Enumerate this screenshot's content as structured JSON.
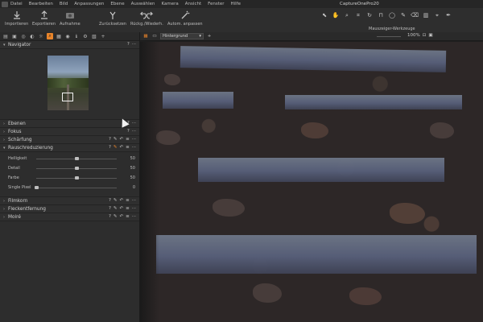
{
  "menu": [
    "Datei",
    "Bearbeiten",
    "Bild",
    "Anpassungen",
    "Ebene",
    "Auswählen",
    "Kamera",
    "Ansicht",
    "Fenster",
    "Hilfe"
  ],
  "window_title": "CaptureOnePro20",
  "toolbar": {
    "import": "Importieren",
    "export": "Exportieren",
    "capture": "Aufnahme",
    "reset": "Zurücksetzen",
    "undo_redo": "Rückg./Wiederh.",
    "auto_adjust": "Autom. anpassen",
    "cursor_tools": "Mauszeiger-Werkzeuge"
  },
  "panel": {
    "navigator": "Navigator",
    "layers": "Ebenen",
    "focus": "Fokus",
    "sharpening": "Schärfung",
    "noise_reduction": "Rauschreduzierung",
    "sliders": [
      {
        "label": "Helligkeit",
        "value": "50",
        "pos": 0.5
      },
      {
        "label": "Detail",
        "value": "50",
        "pos": 0.5
      },
      {
        "label": "Farbe",
        "value": "50",
        "pos": 0.5
      },
      {
        "label": "Single Pixel",
        "value": "0",
        "pos": 0.0
      }
    ],
    "film_grain": "Filmkorn",
    "spot_removal": "Fleckentfernung",
    "moire": "Moiré",
    "help": "?",
    "more": "···"
  },
  "viewer": {
    "layer_select": "Hintergrund",
    "zoom": "100%"
  },
  "colors": {
    "accent": "#e8842a"
  }
}
